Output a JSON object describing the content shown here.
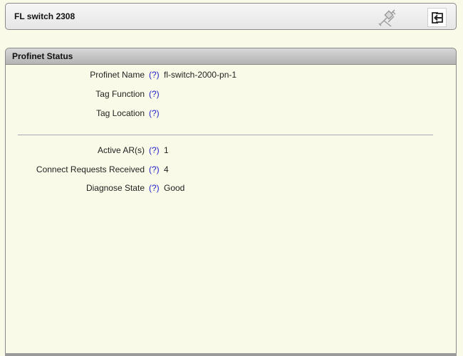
{
  "header": {
    "title": "FL switch 2308"
  },
  "icons": {
    "tool": "wrench-screwdriver-icon",
    "logout": "logout-icon"
  },
  "panel": {
    "title": "Profinet Status",
    "help_text": "(?)",
    "group1": [
      {
        "label": "Profinet Name",
        "value": "fl-switch-2000-pn-1"
      },
      {
        "label": "Tag Function",
        "value": ""
      },
      {
        "label": "Tag Location",
        "value": ""
      }
    ],
    "group2": [
      {
        "label": "Active AR(s)",
        "value": "1"
      },
      {
        "label": "Connect Requests Received",
        "value": "4"
      },
      {
        "label": "Diagnose State",
        "value": "Good"
      }
    ]
  }
}
